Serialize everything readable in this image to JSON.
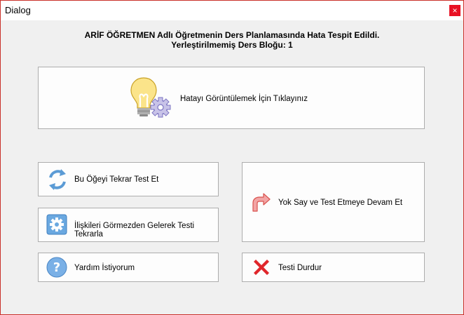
{
  "window": {
    "title": "Dialog",
    "close_label": "×"
  },
  "header": {
    "line1": "ARİF ÖĞRETMEN Adlı Öğretmenin Ders Planlamasında Hata Tespit Edildi.",
    "line2": "Yerleştirilmemiş Ders Bloğu: 1"
  },
  "buttons": {
    "view_error": {
      "label": "Hatayı Görüntülemek İçin Tıklayınız",
      "icon": "lightbulb-gear-icon"
    },
    "retest": {
      "label": "Bu Öğeyi Tekrar Test Et",
      "icon": "refresh-icon"
    },
    "retest_ignore": {
      "label": "İlişkileri Görmezden Gelerek Testi Tekrarla",
      "icon": "gear-icon"
    },
    "help": {
      "label": "Yardım İstiyorum",
      "icon": "question-icon"
    },
    "ignore_continue": {
      "label": "Yok Say ve Test Etmeye Devam Et",
      "icon": "turn-right-arrow-icon"
    },
    "stop": {
      "label": "Testi Durdur",
      "icon": "red-x-icon"
    }
  },
  "colors": {
    "close_bg": "#e81123",
    "window_border": "#c9312a",
    "accent_blue": "#4a90d9",
    "stop_red": "#e0262b"
  }
}
